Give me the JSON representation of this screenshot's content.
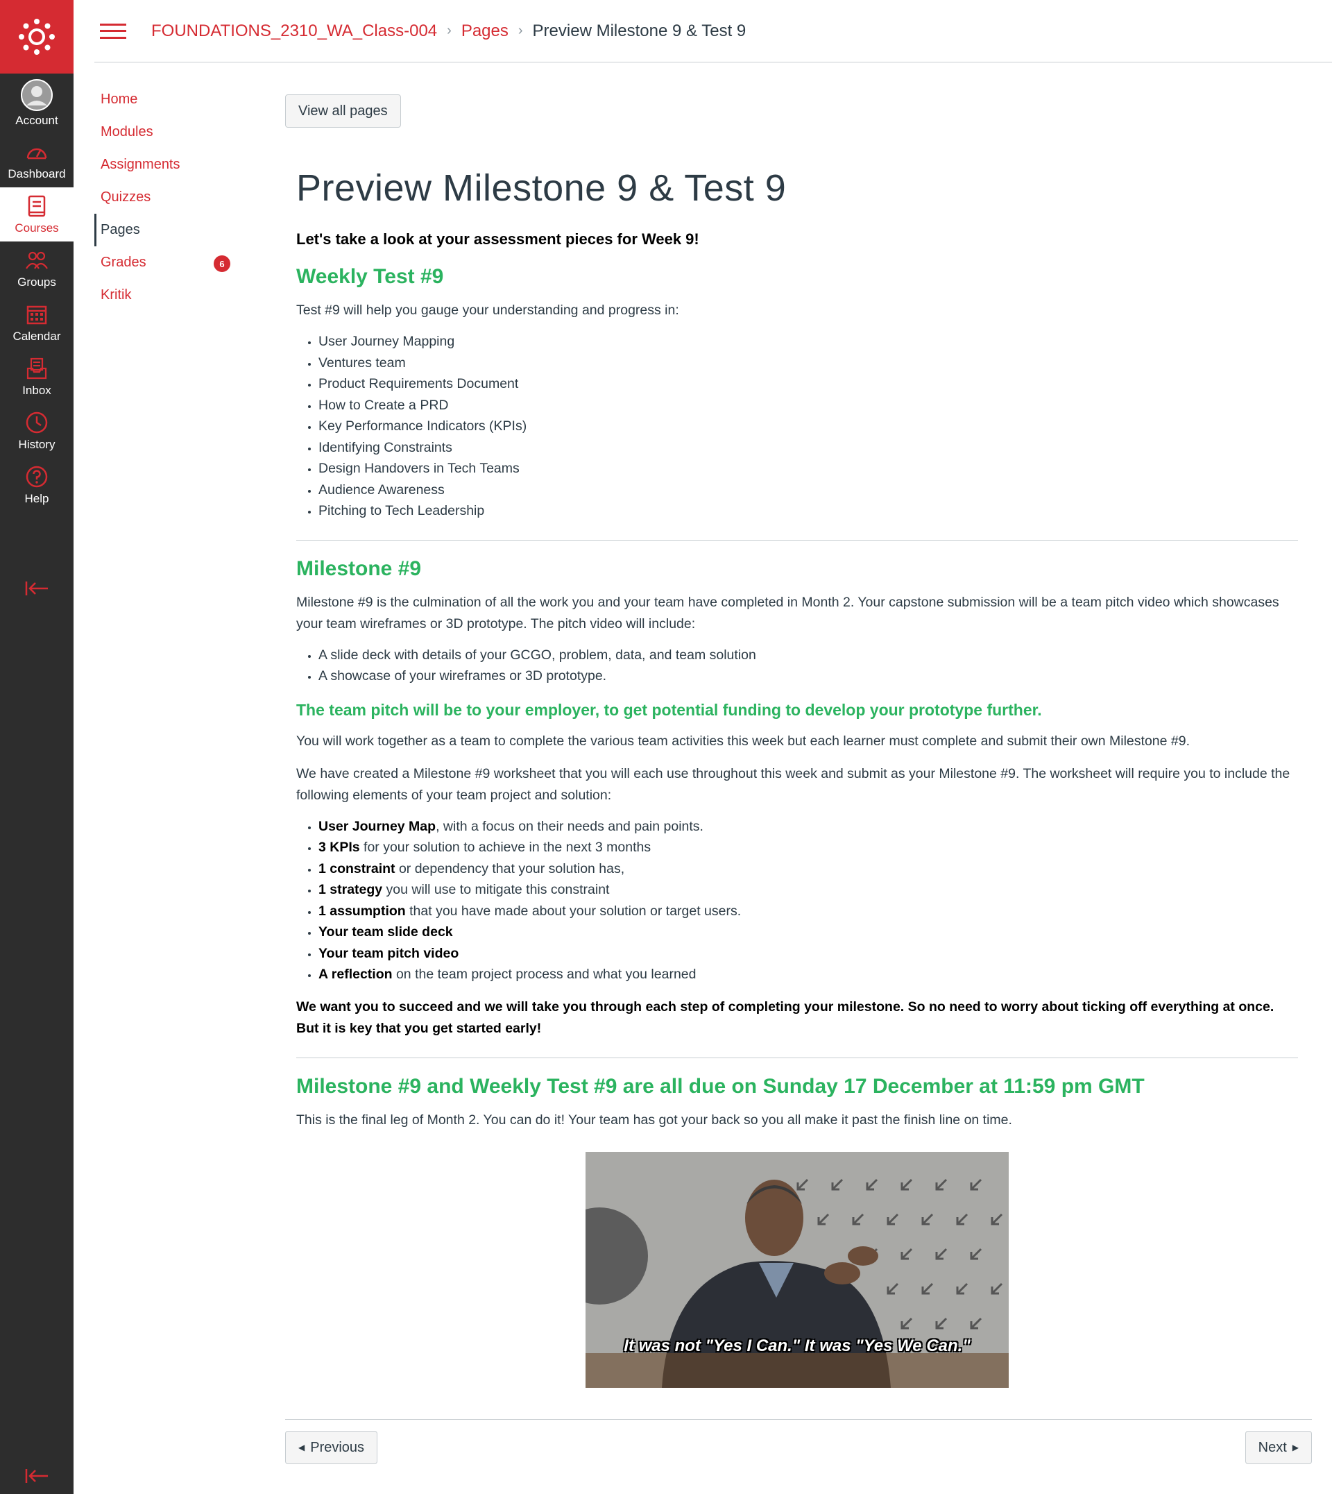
{
  "global_nav": {
    "items": [
      {
        "label": "Account",
        "icon": "avatar-icon"
      },
      {
        "label": "Dashboard",
        "icon": "dashboard-icon"
      },
      {
        "label": "Courses",
        "icon": "courses-icon"
      },
      {
        "label": "Groups",
        "icon": "groups-icon"
      },
      {
        "label": "Calendar",
        "icon": "calendar-icon"
      },
      {
        "label": "Inbox",
        "icon": "inbox-icon"
      },
      {
        "label": "History",
        "icon": "history-icon"
      },
      {
        "label": "Help",
        "icon": "help-icon"
      }
    ],
    "active": "Courses"
  },
  "header": {
    "breadcrumb": {
      "course": "FOUNDATIONS_2310_WA_Class-004",
      "section": "Pages",
      "current": "Preview Milestone 9 & Test 9"
    }
  },
  "course_nav": {
    "items": [
      {
        "label": "Home"
      },
      {
        "label": "Modules"
      },
      {
        "label": "Assignments"
      },
      {
        "label": "Quizzes"
      },
      {
        "label": "Pages"
      },
      {
        "label": "Grades",
        "badge": "6"
      },
      {
        "label": "Kritik"
      }
    ],
    "active": "Pages"
  },
  "content": {
    "view_all_label": "View all pages",
    "title": "Preview Milestone 9 & Test 9",
    "intro": "Let's take a look at your assessment pieces for Week 9!",
    "weekly_test": {
      "heading": "Weekly Test #9",
      "lead": "Test #9 will help you gauge your understanding and progress in:",
      "topics": [
        "User Journey Mapping",
        "Ventures team",
        "Product Requirements Document",
        "How to Create a PRD",
        "Key Performance Indicators (KPIs)",
        "Identifying Constraints",
        "Design Handovers in Tech Teams",
        "Audience Awareness",
        "Pitching to Tech Leadership"
      ]
    },
    "milestone": {
      "heading": "Milestone #9",
      "description": "Milestone #9 is the culmination of all the work you and your team have completed in Month 2. Your capstone submission will be a team pitch video which showcases your team wireframes or 3D prototype. The pitch video will include:",
      "video_items": [
        "A slide deck with details of your GCGO, problem, data, and team solution",
        "A showcase of your wireframes or 3D prototype."
      ],
      "subheading": "The team pitch will be to your employer, to get potential funding to develop your prototype further.",
      "para1": "You will work together as a team to complete the various team activities this week but each learner must complete and submit their own Milestone #9.",
      "para2": "We have created a Milestone #9 worksheet that you will each use throughout this week and submit as your Milestone #9. The worksheet will require you to include the following elements of your team project and solution:",
      "elements": [
        {
          "bold": "User Journey Map",
          "rest": ", with a focus on their needs and pain points."
        },
        {
          "bold": "3 KPIs",
          "rest": " for your solution to achieve in the next 3 months"
        },
        {
          "bold": "1 constraint",
          "rest": " or dependency that your solution has,"
        },
        {
          "bold": "1 strategy",
          "rest": " you will use to mitigate this constraint"
        },
        {
          "bold": "1 assumption",
          "rest": " that you have made about your solution or target users."
        },
        {
          "bold": "Your team slide deck",
          "rest": ""
        },
        {
          "bold": "Your team pitch video",
          "rest": ""
        },
        {
          "bold": "A reflection",
          "rest": " on the team project process and what you learned"
        }
      ],
      "encouragement": "We want you to succeed and we will take you through each step of completing your milestone. So no need to worry about ticking off everything at once. But it is key that you get started early!"
    },
    "due": {
      "heading": "Milestone #9 and Weekly Test #9 are all due on Sunday 17 December at 11:59 pm GMT",
      "text": "This is the final leg of Month 2. You can do it! Your team has got your back so you all make it past the finish line on time.",
      "gif_caption": "It was not \"Yes I Can.\" It was \"Yes We Can.\""
    }
  },
  "footer": {
    "previous_label": "Previous",
    "next_label": "Next"
  },
  "colors": {
    "brand": "#d52b32",
    "nav_bg": "#2d2d2d",
    "heading_green": "#2bb35f"
  }
}
